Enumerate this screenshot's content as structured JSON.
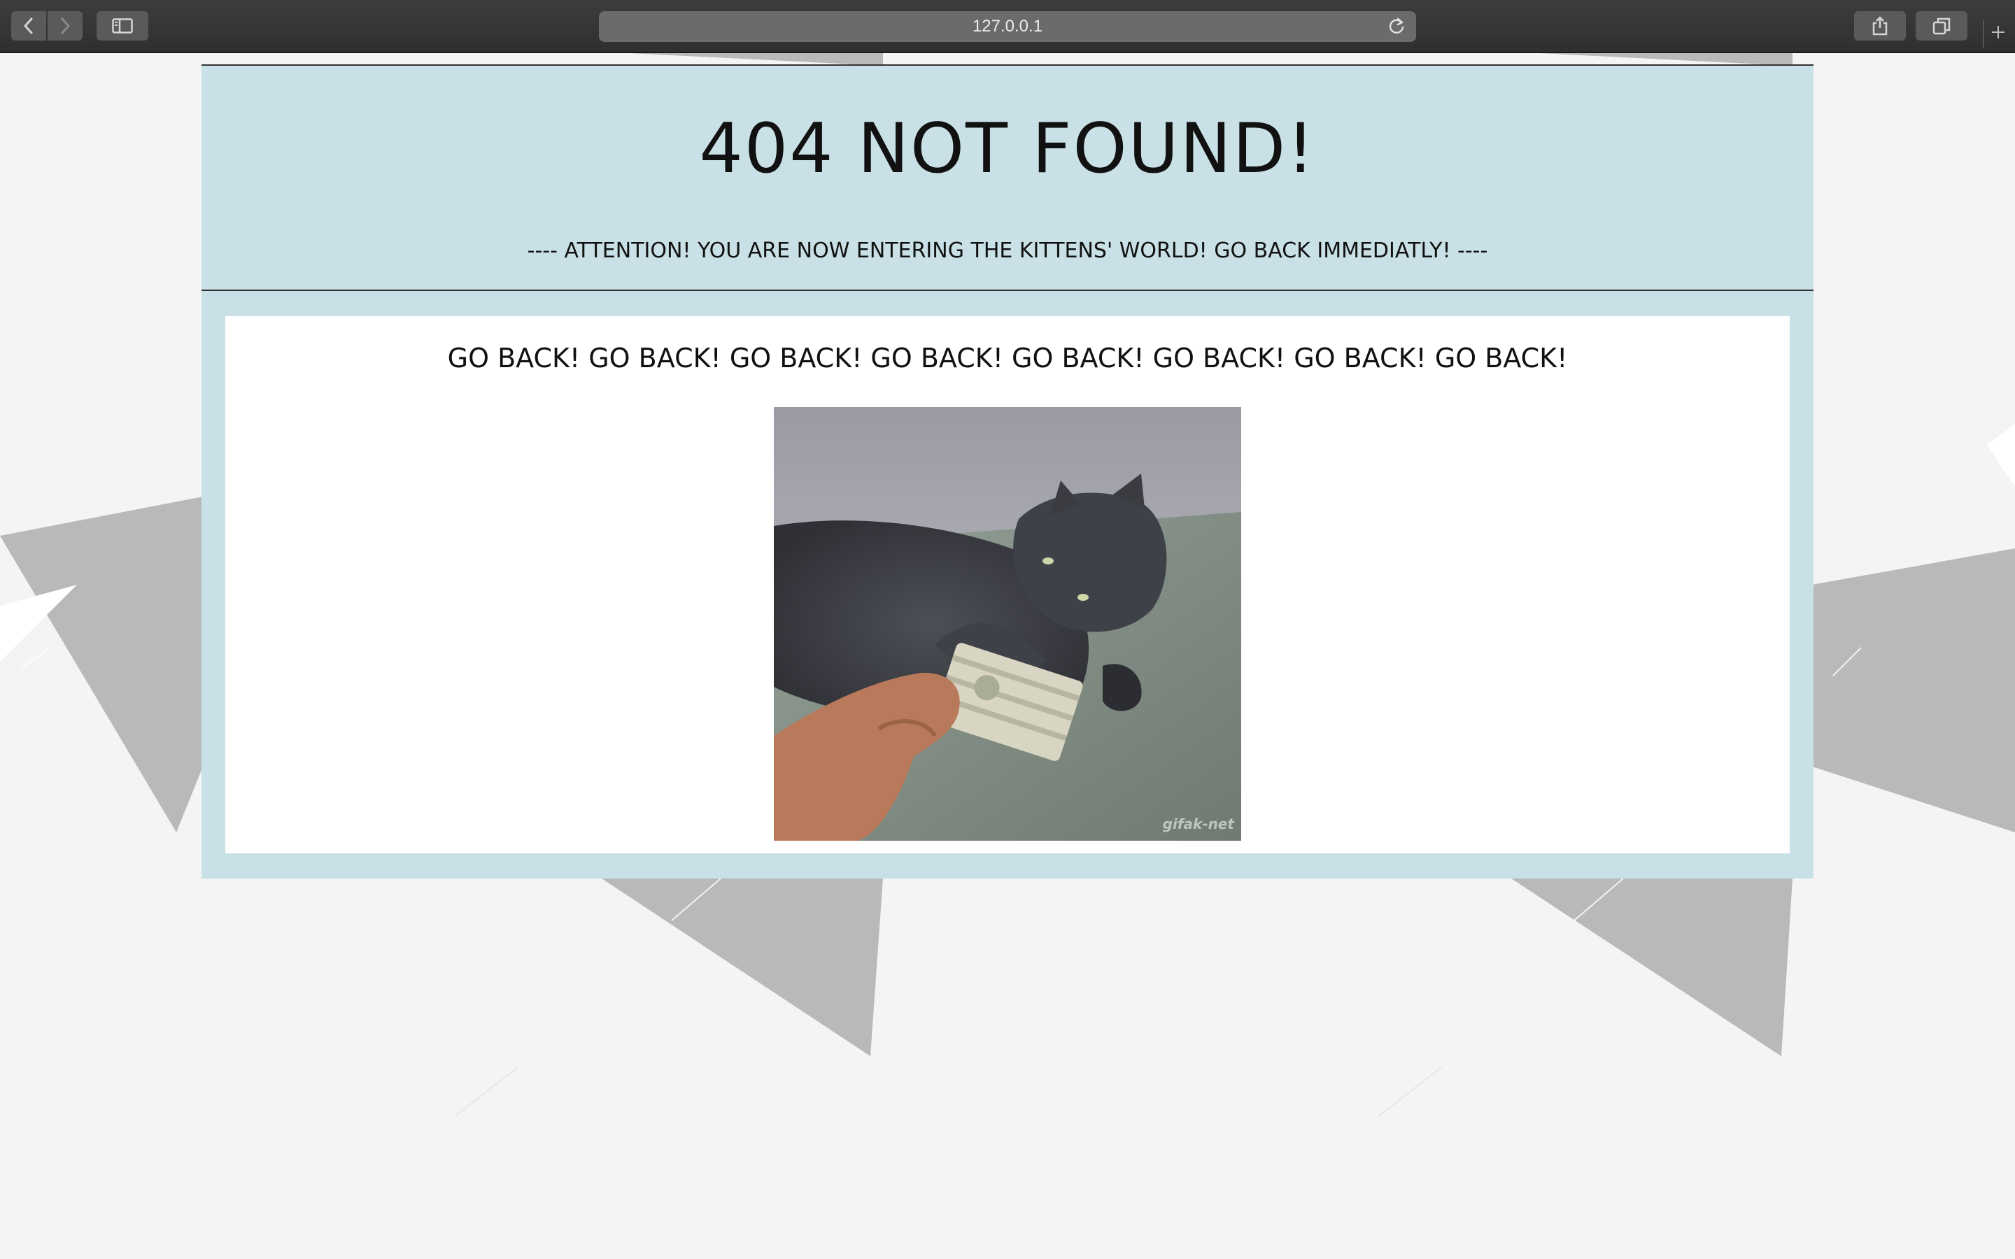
{
  "browser": {
    "url": "127.0.0.1",
    "icons": {
      "back": "chevron-left-icon",
      "forward": "chevron-right-icon",
      "sidebar": "sidebar-icon",
      "reload": "reload-icon",
      "share": "share-icon",
      "tabs": "tabs-overview-icon",
      "new_tab": "plus-icon"
    }
  },
  "page": {
    "title": "404 NOT FOUND!",
    "subtitle": "---- ATTENTION! YOU ARE NOW ENTERING THE KITTENS' WORLD! GO BACK IMMEDIATLY! ----",
    "warning": "GO BACK! GO BACK! GO BACK! GO BACK! GO BACK! GO BACK! GO BACK! GO BACK!",
    "image_watermark": "gifak-net"
  },
  "colors": {
    "header_background": "#c9e1e6",
    "content_background": "#ffffff",
    "page_background": "#f4f4f4",
    "shape_gray": "#b9b9b9"
  }
}
